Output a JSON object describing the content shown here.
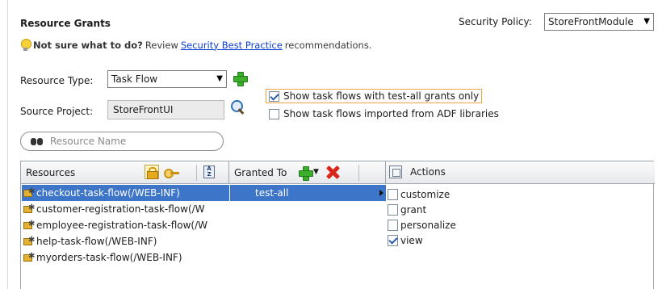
{
  "header": {
    "title": "Resource Grants",
    "security_policy_label": "Security Policy:",
    "security_policy_value": "StoreFrontModule"
  },
  "hint": {
    "bold": "Not sure what to do?",
    "pre": "Review",
    "link": "Security Best Practice",
    "post": "recommendations."
  },
  "form": {
    "resource_type_label": "Resource Type:",
    "resource_type_value": "Task Flow",
    "source_project_label": "Source Project:",
    "source_project_value": "StoreFrontUI",
    "opt_test_all_label": "Show task flows with test-all grants only",
    "opt_test_all_checked": true,
    "opt_adf_label": "Show task flows imported from ADF libraries",
    "opt_adf_checked": false,
    "search_placeholder": "Resource Name"
  },
  "table": {
    "col_resources": "Resources",
    "col_granted_to": "Granted To",
    "col_actions": "Actions",
    "resources": [
      {
        "label": "checkout-task-flow(/WEB-INF)",
        "selected": true
      },
      {
        "label": "customer-registration-task-flow(/W",
        "selected": false
      },
      {
        "label": "employee-registration-task-flow(/W",
        "selected": false
      },
      {
        "label": "help-task-flow(/WEB-INF)",
        "selected": false
      },
      {
        "label": "myorders-task-flow(/WEB-INF)",
        "selected": false
      }
    ],
    "granted_to": [
      {
        "label": "test-all",
        "selected": true
      }
    ],
    "actions": [
      {
        "label": "customize",
        "checked": false
      },
      {
        "label": "grant",
        "checked": false
      },
      {
        "label": "personalize",
        "checked": false
      },
      {
        "label": "view",
        "checked": true
      }
    ]
  },
  "colors": {
    "selection": "#3d75c8",
    "link": "#0b3fd6",
    "highlight_border": "#f0a23c"
  }
}
